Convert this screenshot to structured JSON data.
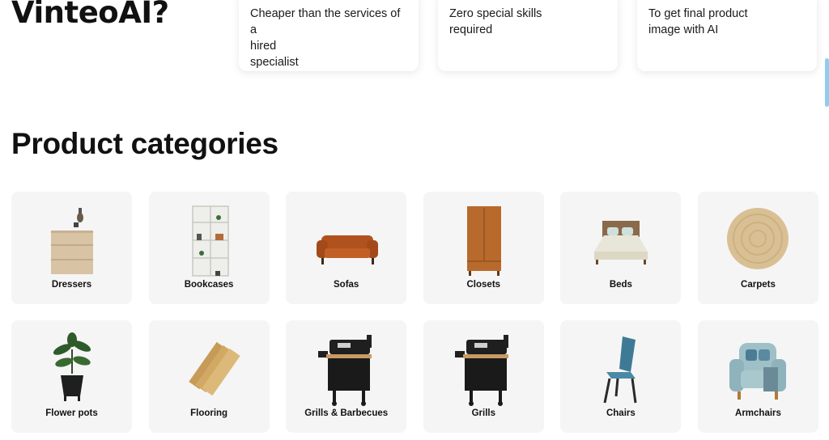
{
  "hero": {
    "title": "VinteoAI?"
  },
  "features": [
    {
      "text": "Cheaper than the services of a\nhired\nspecialist"
    },
    {
      "text": "Zero special skills\nrequired"
    },
    {
      "text": "To get final product\nimage with AI"
    }
  ],
  "section": {
    "title": "Product categories"
  },
  "categories": [
    {
      "label": "Dressers",
      "icon": "dresser-icon"
    },
    {
      "label": "Bookcases",
      "icon": "bookcase-icon"
    },
    {
      "label": "Sofas",
      "icon": "sofa-icon"
    },
    {
      "label": "Closets",
      "icon": "closet-icon"
    },
    {
      "label": "Beds",
      "icon": "bed-icon"
    },
    {
      "label": "Carpets",
      "icon": "carpet-icon"
    },
    {
      "label": "Flower pots",
      "icon": "flower-pot-icon"
    },
    {
      "label": "Flooring",
      "icon": "flooring-icon"
    },
    {
      "label": "Grills & Barbecues",
      "icon": "grill-barbecue-icon"
    },
    {
      "label": "Grills",
      "icon": "grill-icon"
    },
    {
      "label": "Chairs",
      "icon": "chair-icon"
    },
    {
      "label": "Armchairs",
      "icon": "armchair-icon"
    }
  ]
}
